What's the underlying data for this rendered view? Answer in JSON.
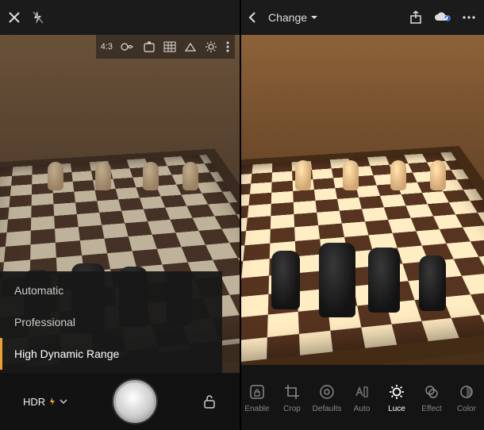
{
  "camera": {
    "topbar": {
      "close": "close-icon",
      "flash": "flash-off-icon"
    },
    "overlay": {
      "aspect_ratio": "4:3"
    },
    "modes": {
      "items": [
        {
          "label": "Automatic",
          "selected": false
        },
        {
          "label": "Professional",
          "selected": false
        },
        {
          "label": "High Dynamic Range",
          "selected": true
        }
      ]
    },
    "bottom": {
      "hdr_label": "HDR"
    }
  },
  "editor": {
    "topbar": {
      "title": "Change"
    },
    "tools": [
      {
        "key": "enable",
        "label": "Enable"
      },
      {
        "key": "crop",
        "label": "Crop"
      },
      {
        "key": "defaults",
        "label": "Defaults"
      },
      {
        "key": "auto",
        "label": "Auto"
      },
      {
        "key": "luce",
        "label": "Luce",
        "active": true
      },
      {
        "key": "effect",
        "label": "Effect"
      },
      {
        "key": "color",
        "label": "Color"
      }
    ]
  },
  "colors": {
    "accent": "#f0a030",
    "sync": "#3a78ff"
  }
}
